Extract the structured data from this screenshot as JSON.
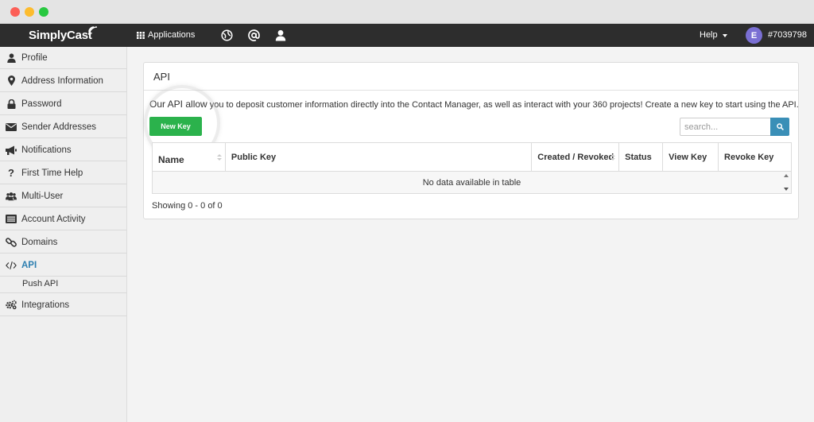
{
  "nav": {
    "logo": "SimplyCast",
    "applications": "Applications",
    "help": "Help",
    "avatar_letter": "E",
    "account_id": "#7039798"
  },
  "sidebar": {
    "items": [
      {
        "label": "Profile",
        "icon": "user-icon"
      },
      {
        "label": "Address Information",
        "icon": "map-marker-icon"
      },
      {
        "label": "Password",
        "icon": "lock-icon"
      },
      {
        "label": "Sender Addresses",
        "icon": "envelope-icon"
      },
      {
        "label": "Notifications",
        "icon": "bullhorn-icon"
      },
      {
        "label": "First Time Help",
        "icon": "question-icon"
      },
      {
        "label": "Multi-User",
        "icon": "users-icon"
      },
      {
        "label": "Account Activity",
        "icon": "list-icon"
      },
      {
        "label": "Domains",
        "icon": "link-icon"
      },
      {
        "label": "API",
        "icon": "code-icon"
      },
      {
        "label": "Push API"
      },
      {
        "label": "Integrations",
        "icon": "gears-icon"
      }
    ]
  },
  "panel": {
    "title": "API",
    "desc_start": "Our API allow",
    "desc_rest": " you to deposit customer information directly into the Contact Manager, as well as interact with your 360 projects! Create a new key to start using the API.",
    "new_key": "New Key",
    "search_placeholder": "search...",
    "columns": [
      "Name",
      "Public Key",
      "Created / Revoked",
      "Status",
      "View Key",
      "Revoke Key"
    ],
    "empty": "No data available in table",
    "showing": "Showing 0 - 0 of 0"
  },
  "colors": {
    "accent": "#2d7fb0",
    "button_green": "#2bb24c",
    "search_blue": "#3a8fb7",
    "topbar": "#2d2d2d"
  }
}
